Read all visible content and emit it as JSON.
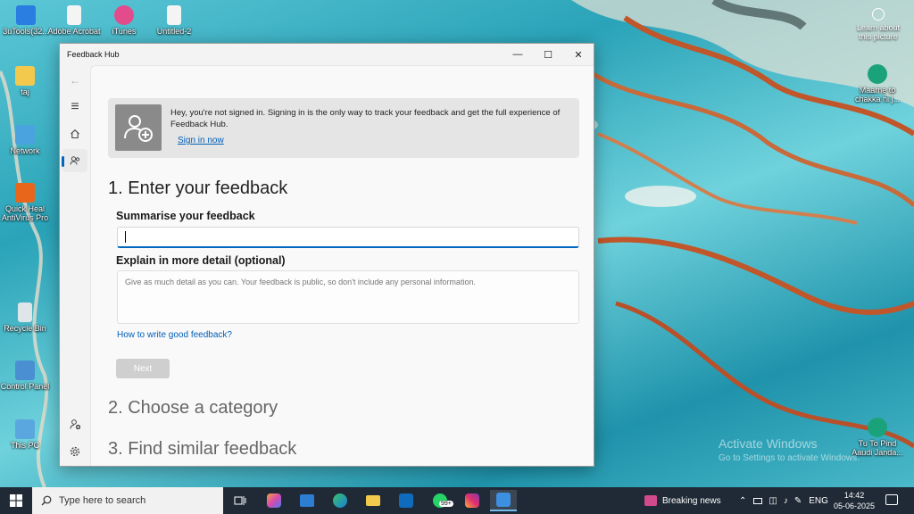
{
  "desktop": {
    "icons": [
      {
        "label": "3uTools(32..."
      },
      {
        "label": "Adobe Acrobat"
      },
      {
        "label": "iTunes"
      },
      {
        "label": "Untitled-2"
      },
      {
        "label": "taj"
      },
      {
        "label": "Network"
      },
      {
        "label": "Quick Heal AntiVirus Pro"
      },
      {
        "label": "Recycle Bin"
      },
      {
        "label": "Control Panel"
      },
      {
        "label": "This PC"
      },
      {
        "label": "Maarne to chakka hi j..."
      },
      {
        "label": "Tu To Pind Aaudi Janda..."
      }
    ],
    "learn_label": "Learn about this picture",
    "watermark_title": "Activate Windows",
    "watermark_sub": "Go to Settings to activate Windows."
  },
  "window": {
    "title": "Feedback Hub",
    "minimize": "—",
    "maximize": "☐",
    "close": "✕"
  },
  "rail": {
    "back": "←",
    "menu": "≡"
  },
  "signin": {
    "message": "Hey, you're not signed in. Signing in is the only way to track your feedback and get the full experience of Feedback Hub.",
    "link": "Sign in now"
  },
  "form": {
    "step1": "1. Enter your feedback",
    "summary_label": "Summarise your feedback",
    "summary_value": "",
    "detail_label": "Explain in more detail (optional)",
    "detail_placeholder": "Give as much detail as you can. Your feedback is public, so don't include any personal information.",
    "help_link": "How to write good feedback?",
    "next": "Next",
    "step2": "2. Choose a category",
    "step3": "3. Find similar feedback"
  },
  "taskbar": {
    "search_placeholder": "Type here to search",
    "whatsapp_badge": "99+",
    "news": "Breaking news",
    "lang": "ENG",
    "time": "14:42",
    "date": "05-06-2025"
  }
}
